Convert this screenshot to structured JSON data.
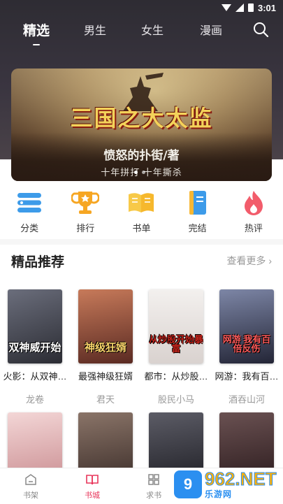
{
  "status_bar": {
    "time": "3:01"
  },
  "top_tabs": [
    {
      "label": "精选",
      "active": true
    },
    {
      "label": "男生",
      "active": false
    },
    {
      "label": "女生",
      "active": false
    },
    {
      "label": "漫画",
      "active": false
    }
  ],
  "banner": {
    "title": "三国之大太监",
    "author": "愤怒的扑街/著",
    "tagline": "十年拼打 十年撕杀",
    "dots": 2,
    "active_dot": 0
  },
  "categories": [
    {
      "label": "分类",
      "icon": "category-icon",
      "color": "#3d9be9"
    },
    {
      "label": "排行",
      "icon": "trophy-icon",
      "color": "#f6a623"
    },
    {
      "label": "书单",
      "icon": "open-book-icon",
      "color": "#f7c948"
    },
    {
      "label": "完结",
      "icon": "bookmark-book-icon",
      "color": "#3d9be9"
    },
    {
      "label": "热评",
      "icon": "flame-icon",
      "color": "#f25c6b"
    }
  ],
  "section": {
    "title": "精品推荐",
    "more": "查看更多"
  },
  "books": [
    {
      "name": "火影：从双神…",
      "author": "龙卷",
      "cover_text": "双神威开始",
      "cover_color": "#3a3b45"
    },
    {
      "name": "最强神级狂婿",
      "author": "君天",
      "cover_text": "神级狂婿",
      "cover_color": "#8a4a38"
    },
    {
      "name": "都市：从炒股…",
      "author": "股民小马",
      "cover_text": "从炒股开始暴富",
      "cover_color": "#e9e4e2"
    },
    {
      "name": "网游：我有百…",
      "author": "酒吞山河",
      "cover_text": "网游 我有百倍反伤",
      "cover_color": "#3a3f56"
    },
    {
      "name": "",
      "author": "",
      "cover_text": "",
      "cover_color": "#e8b7b9"
    },
    {
      "name": "",
      "author": "",
      "cover_text": "",
      "cover_color": "#5a4a4a"
    },
    {
      "name": "",
      "author": "",
      "cover_text": "",
      "cover_color": "#2e2e34"
    },
    {
      "name": "",
      "author": "",
      "cover_text": "",
      "cover_color": "#3a2c2e"
    }
  ],
  "bottom_nav": [
    {
      "label": "书架",
      "active": false,
      "icon": "bookshelf-icon"
    },
    {
      "label": "书城",
      "active": true,
      "icon": "bookstore-icon"
    },
    {
      "label": "求书",
      "active": false,
      "icon": "grid-icon"
    }
  ],
  "watermark": {
    "logo": "9",
    "brand": "962.NET",
    "sub": "乐游网"
  },
  "colors": {
    "accent": "#e8355a",
    "header_bg": "#34313a"
  }
}
